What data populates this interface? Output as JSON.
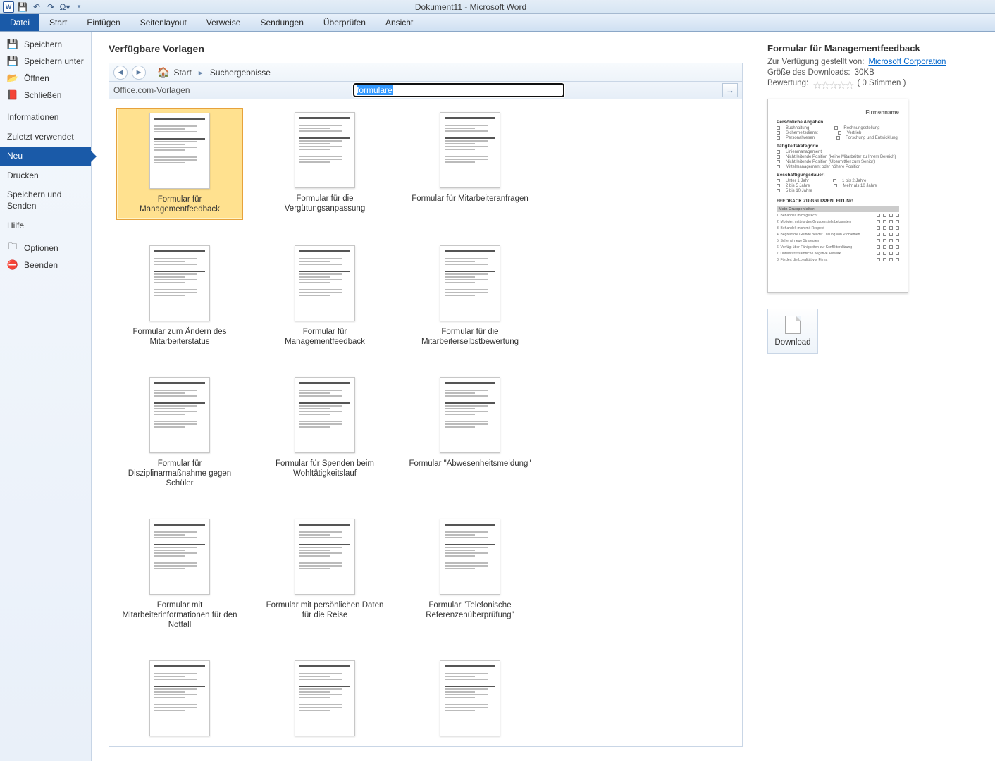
{
  "titlebar": {
    "title": "Dokument11  -  Microsoft Word"
  },
  "ribbon": {
    "file": "Datei",
    "tabs": [
      "Start",
      "Einfügen",
      "Seitenlayout",
      "Verweise",
      "Sendungen",
      "Überprüfen",
      "Ansicht"
    ]
  },
  "sidebar": {
    "save": "Speichern",
    "save_as": "Speichern unter",
    "open": "Öffnen",
    "close": "Schließen",
    "info": "Informationen",
    "recent": "Zuletzt verwendet",
    "new": "Neu",
    "print": "Drucken",
    "save_send": "Speichern und Senden",
    "help": "Hilfe",
    "options": "Optionen",
    "exit": "Beenden"
  },
  "gallery": {
    "heading": "Verfügbare Vorlagen",
    "breadcrumb": {
      "home": "Start",
      "results": "Suchergebnisse"
    },
    "search_label": "Office.com-Vorlagen",
    "search_value": "formulare",
    "items": [
      {
        "label": "Formular für Managementfeedback"
      },
      {
        "label": "Formular für die Vergütungsanpassung"
      },
      {
        "label": "Formular für Mitarbeiteranfragen"
      },
      {
        "label": "Formular zum Ändern des Mitarbeiterstatus"
      },
      {
        "label": "Formular für Managementfeedback"
      },
      {
        "label": "Formular für die Mitarbeiterselbstbewertung"
      },
      {
        "label": "Formular für Disziplinarmaßnahme gegen Schüler"
      },
      {
        "label": "Formular für Spenden beim Wohltätigkeitslauf"
      },
      {
        "label": "Formular \"Abwesenheitsmeldung\""
      },
      {
        "label": "Formular mit Mitarbeiterinformationen für den Notfall"
      },
      {
        "label": "Formular mit persönlichen Daten für die Reise"
      },
      {
        "label": "Formular \"Telefonische Referenzenüberprüfung\""
      },
      {
        "label": ""
      },
      {
        "label": ""
      },
      {
        "label": ""
      }
    ]
  },
  "preview": {
    "title": "Formular für Managementfeedback",
    "provided_label": "Zur Verfügung gestellt von:",
    "provided_by": "Microsoft Corporation",
    "size_label": "Größe des Downloads:",
    "size_value": "30KB",
    "rating_label": "Bewertung:",
    "rating_count": "( 0 Stimmen )",
    "download": "Download",
    "doc": {
      "company": "Firmenname",
      "section1": "Persönliche Angaben",
      "section2": "Tätigkeitskategorie",
      "section3": "Beschäftigungsdauer:",
      "section4": "FEEDBACK ZU GRUPPENLEITUNG",
      "col_header": "Mein Gruppenleiter:"
    }
  }
}
